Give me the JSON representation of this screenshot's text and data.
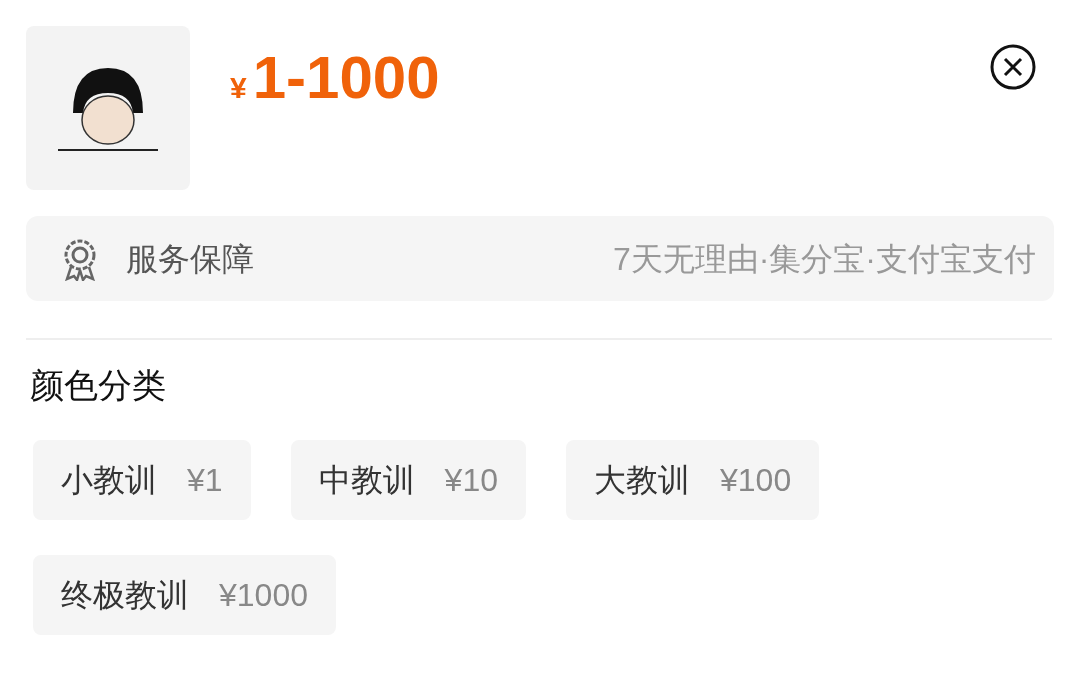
{
  "price": {
    "currency": "¥",
    "range": "1-1000"
  },
  "service": {
    "label": "服务保障",
    "details": "7天无理由·集分宝·支付宝支付"
  },
  "variants": {
    "title": "颜色分类",
    "options": [
      {
        "label": "小教训",
        "price": "¥1",
        "selected": false
      },
      {
        "label": "中教训",
        "price": "¥10",
        "selected": false
      },
      {
        "label": "大教训",
        "price": "¥100",
        "selected": false
      },
      {
        "label": "终极教训",
        "price": "¥1000",
        "selected": false
      }
    ]
  }
}
